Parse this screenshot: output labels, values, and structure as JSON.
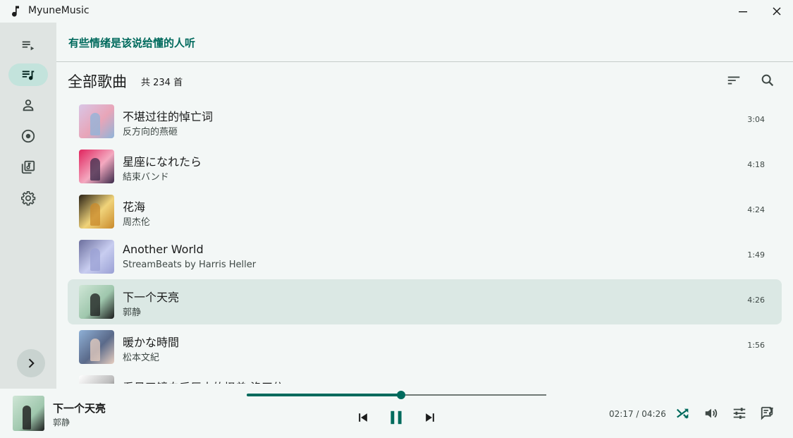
{
  "app": {
    "title": "MyuneMusic"
  },
  "lyric": {
    "current_line": "有些情绪是该说给懂的人听"
  },
  "library": {
    "section_title": "全部歌曲",
    "count_text": "共 234 首"
  },
  "songs": [
    {
      "title": "不堪过往的悼亡词",
      "artist": "反方向的燕砸",
      "duration": "3:04",
      "cover_colors": [
        "#d9c6e6",
        "#8fb4d9",
        "#e8a5b8"
      ]
    },
    {
      "title": "星座になれたら",
      "artist": "結束バンド",
      "duration": "4:18",
      "cover_colors": [
        "#e0245e",
        "#3b2a4a",
        "#f4a9c0"
      ]
    },
    {
      "title": "花海",
      "artist": "周杰伦",
      "duration": "4:24",
      "cover_colors": [
        "#2a2216",
        "#c98a2b",
        "#f0d37a"
      ]
    },
    {
      "title": "Another World",
      "artist": "StreamBeats by Harris Heller",
      "duration": "1:49",
      "cover_colors": [
        "#6c6f9e",
        "#9aa0d4",
        "#c8cdf0"
      ]
    },
    {
      "title": "下一个天亮",
      "artist": "郭静",
      "duration": "4:26",
      "cover_colors": [
        "#cfe6d6",
        "#1b1c1c",
        "#9fc7ad"
      ]
    },
    {
      "title": "暖かな時間",
      "artist": "松本文紀",
      "duration": "1:56",
      "cover_colors": [
        "#8fb0d6",
        "#e8cfc0",
        "#5a6a8a"
      ]
    },
    {
      "title": "看见了镜自后巨大的怪兽 洛天依",
      "artist": "",
      "duration": "",
      "cover_colors": [
        "#ffffff",
        "#222222",
        "#bbbbbb"
      ]
    }
  ],
  "selected_index": 4,
  "player": {
    "title": "下一个天亮",
    "artist": "郭静",
    "elapsed": "02:17",
    "total": "04:26",
    "time_separator": " / ",
    "progress_fraction": 0.515
  },
  "colors": {
    "accent": "#006a5d",
    "selected_row": "#dbe8e4",
    "sidebar": "#dfe4e2",
    "nav_active": "#c3e3dc"
  },
  "icons": [
    "music-note-icon",
    "minimize-icon",
    "close-icon",
    "queue-icon",
    "library-music-icon",
    "artist-icon",
    "album-icon",
    "folder-music-icon",
    "settings-icon",
    "chevron-right-icon",
    "sort-icon",
    "search-icon",
    "skip-previous-icon",
    "pause-icon",
    "skip-next-icon",
    "shuffle-icon",
    "volume-icon",
    "equalizer-icon",
    "lyrics-icon"
  ]
}
